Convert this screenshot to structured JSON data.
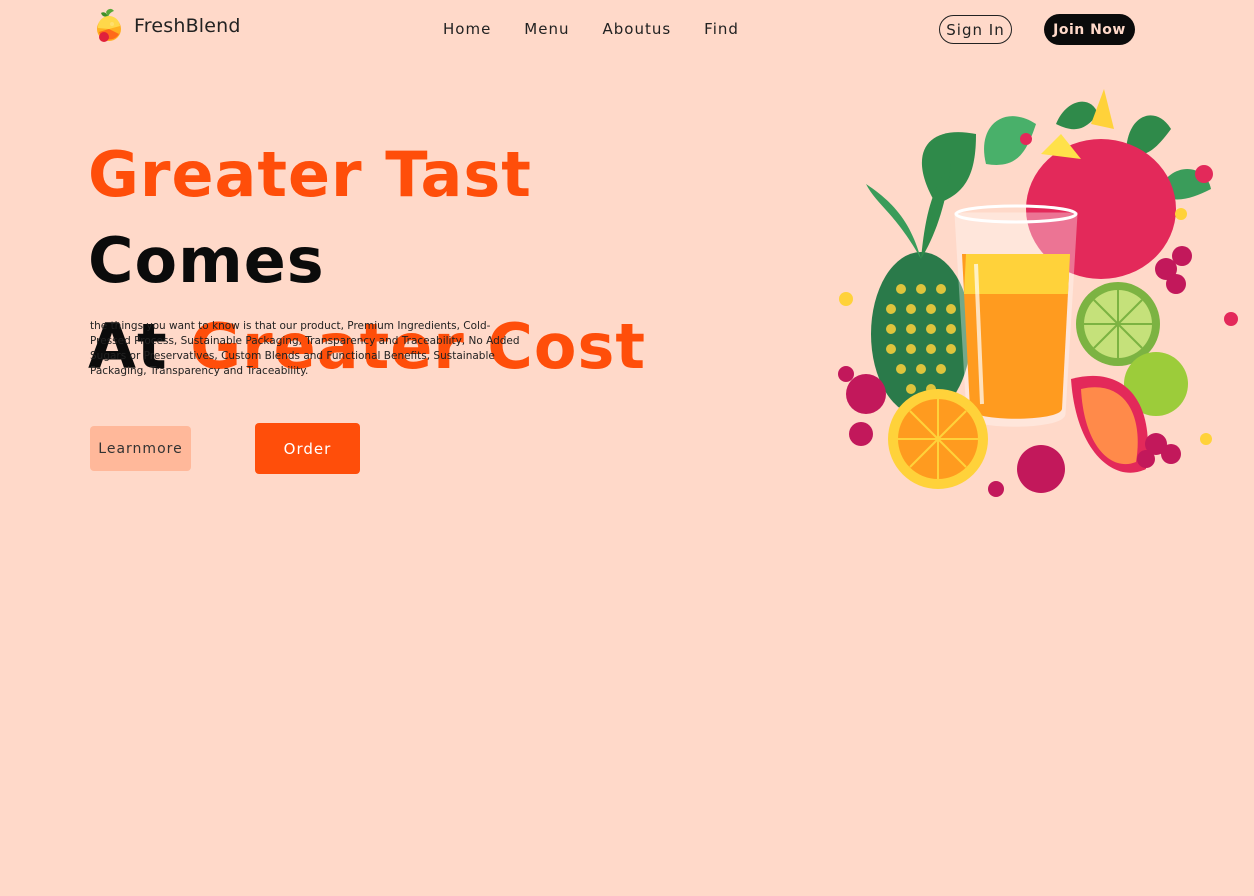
{
  "brand": {
    "name": "FreshBlend",
    "logo_icon": "fruit-logo-icon"
  },
  "nav": {
    "links": [
      "Home",
      "Menu",
      "Aboutus",
      "Find"
    ],
    "sign_in": "Sign In",
    "join_now": "Join Now"
  },
  "hero": {
    "headline": {
      "part1": "Greater Tast",
      "part2": "Comes",
      "part3": "At",
      "part4": "Greater Cost"
    },
    "description": "the things you want to know is that our product, Premium Ingredients, Cold-Pressed Process, Sustainable Packaging, Transparency and Traceability, No Added Sugars or Preservatives, Custom Blends and Functional Benefits, Sustainable Packaging, Transparency and Traceability.",
    "learn_more": "Learnmore",
    "order": "Order",
    "image_icon": "fruit-juice-illustration"
  },
  "colors": {
    "background": "#ffd9c9",
    "accent": "#ff4e0a",
    "accent_light": "#ffb89a",
    "dark": "#0b0b0b"
  }
}
